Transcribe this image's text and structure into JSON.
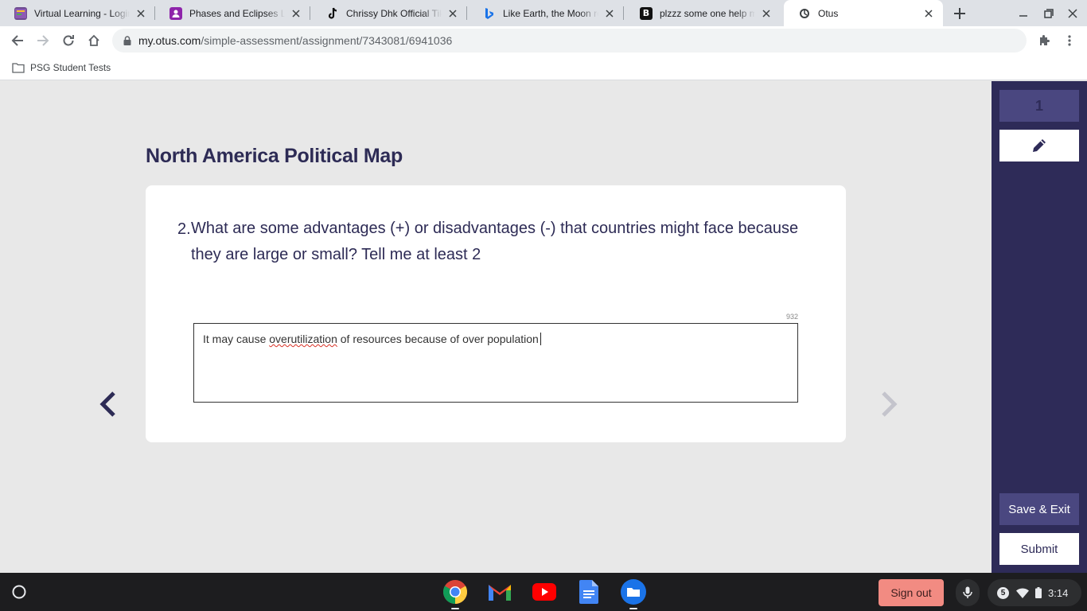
{
  "browser": {
    "tabs": [
      {
        "title": "Virtual Learning - Login",
        "icon": "classroom-icon"
      },
      {
        "title": "Phases and Eclipses Lesson",
        "icon": "classroom-icon"
      },
      {
        "title": "Chrissy Dhk Official Tik Tok",
        "icon": "tiktok-icon"
      },
      {
        "title": "Like Earth, the Moon rotates",
        "icon": "bing-icon"
      },
      {
        "title": "plzzz some one help me",
        "icon": "brainly-icon"
      },
      {
        "title": "Otus",
        "icon": "otus-icon"
      }
    ],
    "url_host": "my.otus.com",
    "url_path": "/simple-assessment/assignment/7343081/6941036",
    "bookmark": "PSG Student Tests"
  },
  "page": {
    "title": "North America Political Map",
    "question_number": "2.",
    "question_text": "What are some advantages (+) or disadvantages (-) that countries might face because they are large or small? Tell me at least 2",
    "char_count": "932",
    "answer_before": "It may cause ",
    "answer_misspelled": "overutilization",
    "answer_after": " of resources because of over population"
  },
  "sidebar": {
    "question_indicator": "1",
    "save_label": "Save & Exit",
    "submit_label": "Submit"
  },
  "shelf": {
    "sign_out": "Sign out",
    "notification_count": "5",
    "time": "3:14"
  },
  "colors": {
    "accent": "#2e2b58",
    "title": "#2d2b55"
  }
}
